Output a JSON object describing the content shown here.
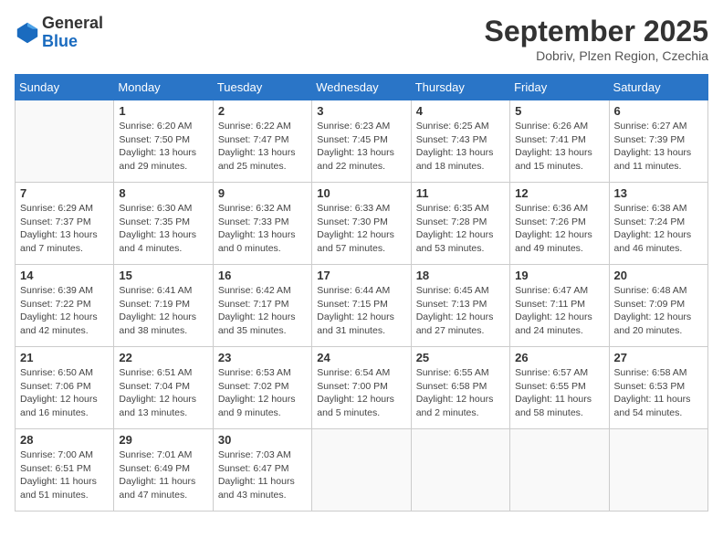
{
  "header": {
    "logo_general": "General",
    "logo_blue": "Blue",
    "month_title": "September 2025",
    "location": "Dobriv, Plzen Region, Czechia"
  },
  "weekdays": [
    "Sunday",
    "Monday",
    "Tuesday",
    "Wednesday",
    "Thursday",
    "Friday",
    "Saturday"
  ],
  "weeks": [
    [
      {
        "day": "",
        "info": ""
      },
      {
        "day": "1",
        "info": "Sunrise: 6:20 AM\nSunset: 7:50 PM\nDaylight: 13 hours\nand 29 minutes."
      },
      {
        "day": "2",
        "info": "Sunrise: 6:22 AM\nSunset: 7:47 PM\nDaylight: 13 hours\nand 25 minutes."
      },
      {
        "day": "3",
        "info": "Sunrise: 6:23 AM\nSunset: 7:45 PM\nDaylight: 13 hours\nand 22 minutes."
      },
      {
        "day": "4",
        "info": "Sunrise: 6:25 AM\nSunset: 7:43 PM\nDaylight: 13 hours\nand 18 minutes."
      },
      {
        "day": "5",
        "info": "Sunrise: 6:26 AM\nSunset: 7:41 PM\nDaylight: 13 hours\nand 15 minutes."
      },
      {
        "day": "6",
        "info": "Sunrise: 6:27 AM\nSunset: 7:39 PM\nDaylight: 13 hours\nand 11 minutes."
      }
    ],
    [
      {
        "day": "7",
        "info": "Sunrise: 6:29 AM\nSunset: 7:37 PM\nDaylight: 13 hours\nand 7 minutes."
      },
      {
        "day": "8",
        "info": "Sunrise: 6:30 AM\nSunset: 7:35 PM\nDaylight: 13 hours\nand 4 minutes."
      },
      {
        "day": "9",
        "info": "Sunrise: 6:32 AM\nSunset: 7:33 PM\nDaylight: 13 hours\nand 0 minutes."
      },
      {
        "day": "10",
        "info": "Sunrise: 6:33 AM\nSunset: 7:30 PM\nDaylight: 12 hours\nand 57 minutes."
      },
      {
        "day": "11",
        "info": "Sunrise: 6:35 AM\nSunset: 7:28 PM\nDaylight: 12 hours\nand 53 minutes."
      },
      {
        "day": "12",
        "info": "Sunrise: 6:36 AM\nSunset: 7:26 PM\nDaylight: 12 hours\nand 49 minutes."
      },
      {
        "day": "13",
        "info": "Sunrise: 6:38 AM\nSunset: 7:24 PM\nDaylight: 12 hours\nand 46 minutes."
      }
    ],
    [
      {
        "day": "14",
        "info": "Sunrise: 6:39 AM\nSunset: 7:22 PM\nDaylight: 12 hours\nand 42 minutes."
      },
      {
        "day": "15",
        "info": "Sunrise: 6:41 AM\nSunset: 7:19 PM\nDaylight: 12 hours\nand 38 minutes."
      },
      {
        "day": "16",
        "info": "Sunrise: 6:42 AM\nSunset: 7:17 PM\nDaylight: 12 hours\nand 35 minutes."
      },
      {
        "day": "17",
        "info": "Sunrise: 6:44 AM\nSunset: 7:15 PM\nDaylight: 12 hours\nand 31 minutes."
      },
      {
        "day": "18",
        "info": "Sunrise: 6:45 AM\nSunset: 7:13 PM\nDaylight: 12 hours\nand 27 minutes."
      },
      {
        "day": "19",
        "info": "Sunrise: 6:47 AM\nSunset: 7:11 PM\nDaylight: 12 hours\nand 24 minutes."
      },
      {
        "day": "20",
        "info": "Sunrise: 6:48 AM\nSunset: 7:09 PM\nDaylight: 12 hours\nand 20 minutes."
      }
    ],
    [
      {
        "day": "21",
        "info": "Sunrise: 6:50 AM\nSunset: 7:06 PM\nDaylight: 12 hours\nand 16 minutes."
      },
      {
        "day": "22",
        "info": "Sunrise: 6:51 AM\nSunset: 7:04 PM\nDaylight: 12 hours\nand 13 minutes."
      },
      {
        "day": "23",
        "info": "Sunrise: 6:53 AM\nSunset: 7:02 PM\nDaylight: 12 hours\nand 9 minutes."
      },
      {
        "day": "24",
        "info": "Sunrise: 6:54 AM\nSunset: 7:00 PM\nDaylight: 12 hours\nand 5 minutes."
      },
      {
        "day": "25",
        "info": "Sunrise: 6:55 AM\nSunset: 6:58 PM\nDaylight: 12 hours\nand 2 minutes."
      },
      {
        "day": "26",
        "info": "Sunrise: 6:57 AM\nSunset: 6:55 PM\nDaylight: 11 hours\nand 58 minutes."
      },
      {
        "day": "27",
        "info": "Sunrise: 6:58 AM\nSunset: 6:53 PM\nDaylight: 11 hours\nand 54 minutes."
      }
    ],
    [
      {
        "day": "28",
        "info": "Sunrise: 7:00 AM\nSunset: 6:51 PM\nDaylight: 11 hours\nand 51 minutes."
      },
      {
        "day": "29",
        "info": "Sunrise: 7:01 AM\nSunset: 6:49 PM\nDaylight: 11 hours\nand 47 minutes."
      },
      {
        "day": "30",
        "info": "Sunrise: 7:03 AM\nSunset: 6:47 PM\nDaylight: 11 hours\nand 43 minutes."
      },
      {
        "day": "",
        "info": ""
      },
      {
        "day": "",
        "info": ""
      },
      {
        "day": "",
        "info": ""
      },
      {
        "day": "",
        "info": ""
      }
    ]
  ]
}
